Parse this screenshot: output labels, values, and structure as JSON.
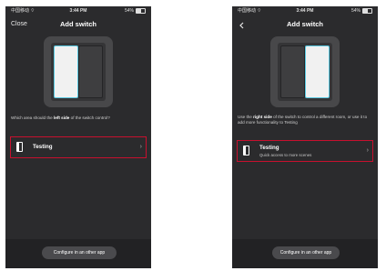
{
  "screens": [
    {
      "status": {
        "carrier": "中国移动",
        "time": "3:44 PM",
        "battery": "54%"
      },
      "nav": {
        "close_label": "Close",
        "title": "Add switch"
      },
      "question_parts": [
        "Which area should the ",
        "left side",
        " of the switch control?"
      ],
      "room": {
        "name": "Testing",
        "subtitle": ""
      },
      "config_button": "Configure in an other app"
    },
    {
      "status": {
        "carrier": "中国移动",
        "time": "3:44 PM",
        "battery": "54%"
      },
      "nav": {
        "title": "Add switch"
      },
      "question_parts": [
        "Use the ",
        "right side",
        " of the switch to control a different room, or use it to add more functionality to Testing"
      ],
      "room": {
        "name": "Testing",
        "subtitle": "Quick access to more scenes"
      },
      "config_button": "Configure in an other app"
    }
  ],
  "colors": {
    "background": "#2b2b2d",
    "highlight_border": "#c8102e",
    "rocker_selected": "#58c8e0"
  },
  "icons": [
    "wifi-icon",
    "battery-icon",
    "back-chevron-icon",
    "switch-icon",
    "chevron-right-icon"
  ]
}
